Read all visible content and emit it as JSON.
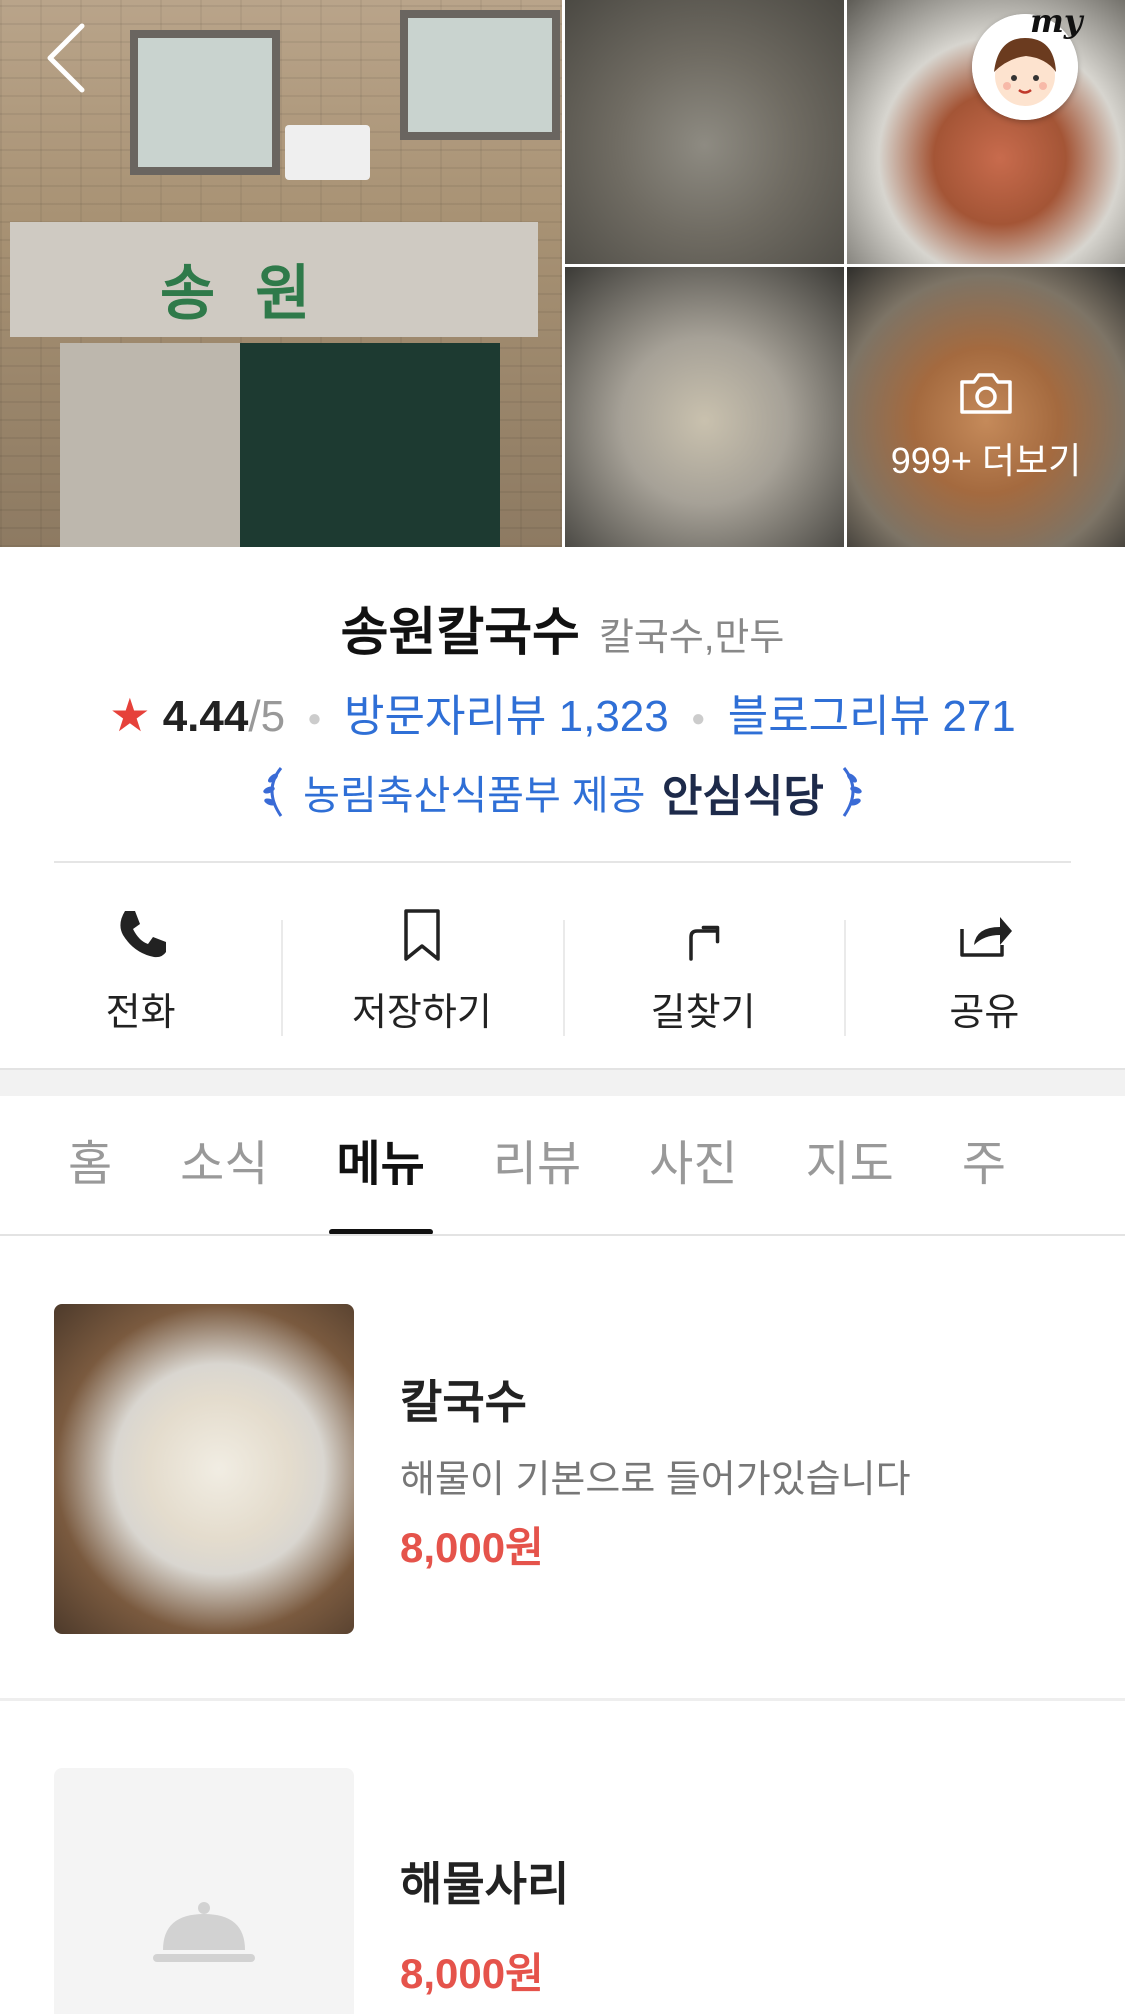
{
  "header": {
    "my_label": "my",
    "more_photos_label": "999+ 더보기"
  },
  "place": {
    "name": "송원칼국수",
    "category": "칼국수,만두",
    "rating": "4.44",
    "rating_max": "/5",
    "visitor_reviews": "방문자리뷰 1,323",
    "blog_reviews": "블로그리뷰 271",
    "certified_by": "농림축산식품부 제공",
    "certification": "안심식당"
  },
  "actions": [
    {
      "label": "전화",
      "icon": "phone-icon"
    },
    {
      "label": "저장하기",
      "icon": "bookmark-icon"
    },
    {
      "label": "길찾기",
      "icon": "directions-icon"
    },
    {
      "label": "공유",
      "icon": "share-icon"
    }
  ],
  "tabs": [
    {
      "label": "홈"
    },
    {
      "label": "소식"
    },
    {
      "label": "메뉴",
      "active": true
    },
    {
      "label": "리뷰"
    },
    {
      "label": "사진"
    },
    {
      "label": "지도"
    },
    {
      "label": "주"
    }
  ],
  "menu": [
    {
      "name": "칼국수",
      "description": "해물이 기본으로 들어가있습니다",
      "price": "8,000원"
    },
    {
      "name": "해물사리",
      "price": "8,000원"
    }
  ],
  "colors": {
    "accent_blue": "#2f6fd6",
    "price_red": "#e5534b",
    "star_red": "#e6413a"
  }
}
